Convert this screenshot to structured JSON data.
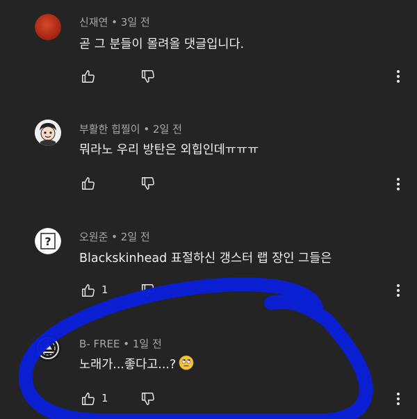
{
  "comments": [
    {
      "author": "신재연",
      "time": "3일 전",
      "text": "곧 그 분들이 몰려올 댓글입니다.",
      "likes": "",
      "avatar": "red-circle-avatar"
    },
    {
      "author": "부활한 힙찔이",
      "time": "2일 전",
      "text": "뭐라노 우리 방탄은 외힙인데ㅠㅠㅠ",
      "likes": "",
      "avatar": "cartoon-face-avatar"
    },
    {
      "author": "오원준",
      "time": "2일 전",
      "text": "Blackskinhead 표절하신 갱스터 랩 장인 그들은",
      "likes": "1",
      "avatar": "question-mark-avatar"
    },
    {
      "author": "B- FREE",
      "time": "1일 전",
      "text": "노래가...좋다고...?",
      "likes": "1",
      "avatar": "emblem-avatar",
      "emoji": "face-with-rolling-eyes-emoji"
    }
  ],
  "meta_separator": " • ",
  "colors": {
    "background": "#242424",
    "meta_text": "#a8a8a8",
    "body_text": "#f1f1f1",
    "annotation_stroke": "#0a1fd8"
  },
  "icons": {
    "like": "thumbs-up-icon",
    "dislike": "thumbs-down-icon",
    "more": "vertical-ellipsis-icon"
  }
}
